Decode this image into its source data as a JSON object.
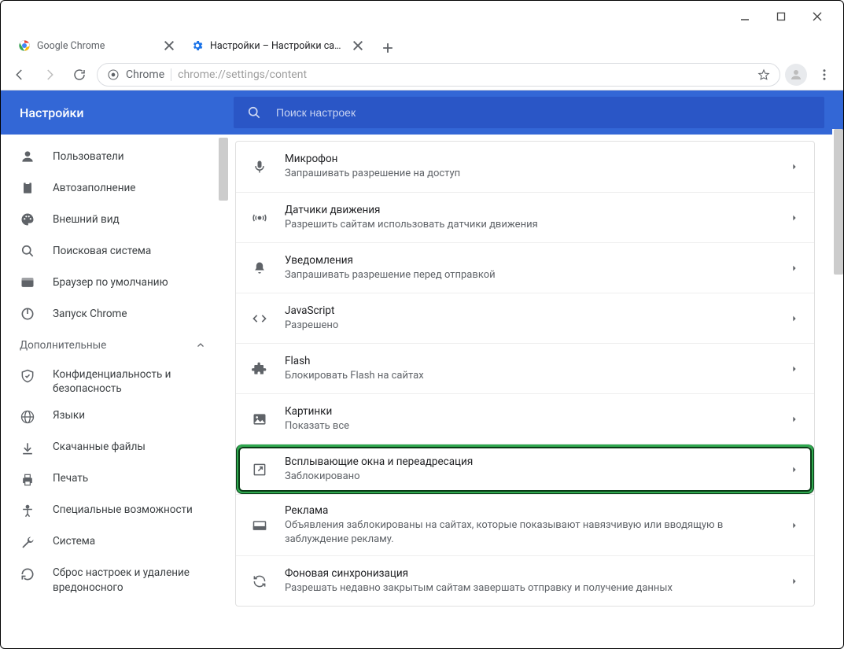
{
  "window": {
    "tabs": [
      {
        "title": "Google Chrome"
      },
      {
        "title": "Настройки – Настройки сайта"
      }
    ],
    "active_tab_index": 1,
    "omnibox_scheme": "Chrome",
    "omnibox_url": "chrome://settings/content"
  },
  "page_header": {
    "title": "Настройки",
    "search_placeholder": "Поиск настроек"
  },
  "sidebar": {
    "items": [
      {
        "label": "Пользователи"
      },
      {
        "label": "Автозаполнение"
      },
      {
        "label": "Внешний вид"
      },
      {
        "label": "Поисковая система"
      },
      {
        "label": "Браузер по умолчанию"
      },
      {
        "label": "Запуск Chrome"
      }
    ],
    "advanced_label": "Дополнительные",
    "advanced_items": [
      {
        "label": "Конфиденциальность и безопасность"
      },
      {
        "label": "Языки"
      },
      {
        "label": "Скачанные файлы"
      },
      {
        "label": "Печать"
      },
      {
        "label": "Специальные возможности"
      },
      {
        "label": "Система"
      },
      {
        "label": "Сброс настроек и удаление вредоносного"
      }
    ]
  },
  "settings": [
    {
      "title": "Микрофон",
      "subtitle": "Запрашивать разрешение на доступ"
    },
    {
      "title": "Датчики движения",
      "subtitle": "Разрешить сайтам использовать датчики движения"
    },
    {
      "title": "Уведомления",
      "subtitle": "Запрашивать разрешение перед отправкой"
    },
    {
      "title": "JavaScript",
      "subtitle": "Разрешено"
    },
    {
      "title": "Flash",
      "subtitle": "Блокировать Flash на сайтах"
    },
    {
      "title": "Картинки",
      "subtitle": "Показать все"
    },
    {
      "title": "Всплывающие окна и переадресация",
      "subtitle": "Заблокировано"
    },
    {
      "title": "Реклама",
      "subtitle": "Объявления заблокированы на сайтах, которые показывают навязчивую или вводящую в заблуждение рекламу."
    },
    {
      "title": "Фоновая синхронизация",
      "subtitle": "Разрешать недавно закрытым сайтам завершать отправку и получение данных"
    }
  ]
}
